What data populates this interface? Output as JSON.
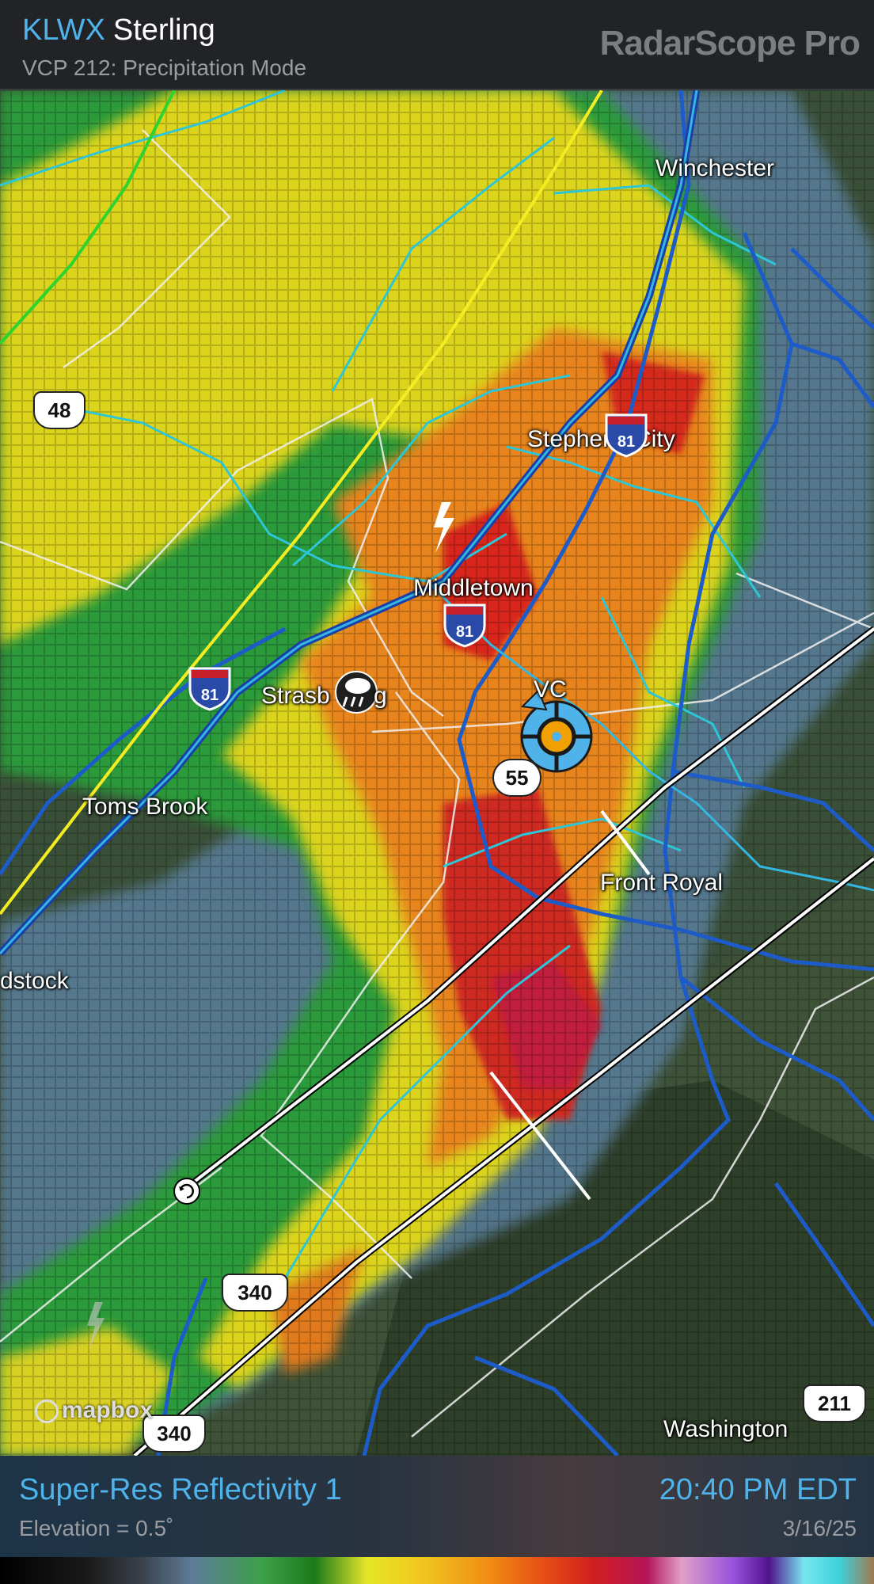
{
  "header": {
    "station_code": "KLWX",
    "station_city": "Sterling",
    "vcp": "VCP 212: Precipitation Mode",
    "brand": "RadarScope Pro"
  },
  "map": {
    "cities": {
      "winchester": "Winchester",
      "stephens_city": "Stephens City",
      "middletown": "Middletown",
      "strasburg": "Strasb",
      "strasburg_tail": "g",
      "toms_brook": "Toms Brook",
      "woodstock": "dstock",
      "front_royal": "Front Royal",
      "washington": "Washington"
    },
    "shields": {
      "us48": "48",
      "va55": "55",
      "us340": "340",
      "us340_b": "340",
      "us211": "211",
      "i81_a": "81",
      "i81_b": "81",
      "i81_c": "81"
    },
    "partial_label": "VC",
    "attribution": "mapbox"
  },
  "footer": {
    "product": "Super-Res Reflectivity 1",
    "elevation": "Elevation = 0.5˚",
    "time": "20:40 PM EDT",
    "date": "3/16/25"
  },
  "colors": {
    "accent": "#4fb3ea",
    "header_bg": "#222326"
  }
}
